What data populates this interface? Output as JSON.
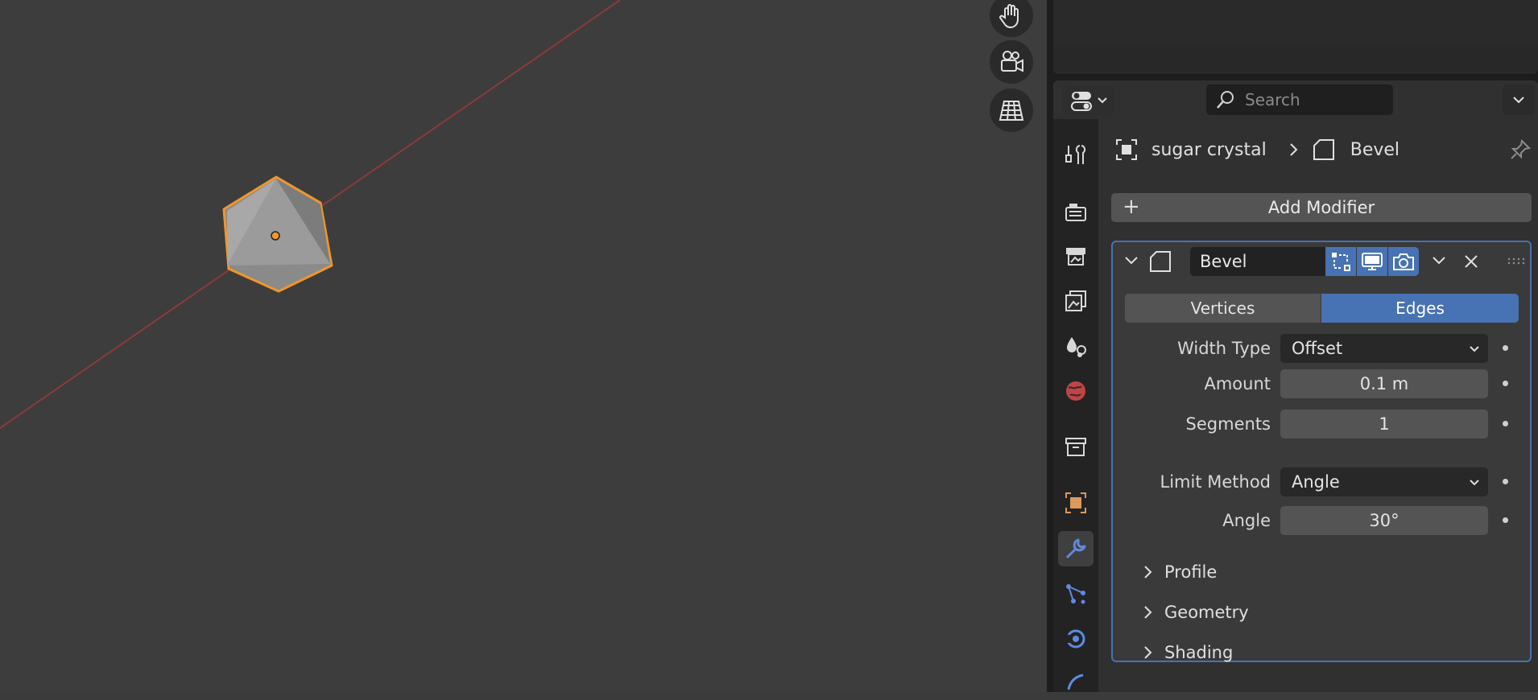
{
  "viewport": {
    "nav_icons": [
      "hand-icon",
      "camera-icon",
      "grid-icon"
    ]
  },
  "properties": {
    "search": {
      "placeholder": "Search"
    },
    "tabs": [
      "tool-icon",
      "render-icon",
      "output-icon",
      "view-layer-icon",
      "scene-icon",
      "world-icon",
      "collection-icon",
      "object-icon",
      "modifier-icon",
      "particles-icon",
      "physics-icon",
      "constraints-icon"
    ],
    "active_tab": "modifier-icon",
    "breadcrumb": {
      "object": "sugar crystal",
      "modifier": "Bevel"
    },
    "add_modifier_label": "Add Modifier",
    "modifier": {
      "name": "Bevel",
      "affect": {
        "options": [
          "Vertices",
          "Edges"
        ],
        "selected": "Edges"
      },
      "width_type": {
        "label": "Width Type",
        "value": "Offset"
      },
      "amount": {
        "label": "Amount",
        "value": "0.1 m"
      },
      "segments": {
        "label": "Segments",
        "value": "1"
      },
      "limit_method": {
        "label": "Limit Method",
        "value": "Angle"
      },
      "angle": {
        "label": "Angle",
        "value": "30°"
      },
      "subpanels": [
        "Profile",
        "Geometry",
        "Shading"
      ]
    }
  },
  "colors": {
    "accent": "#4772b3",
    "selection_outline": "#f0962c",
    "x_axis": "#8c3a3a"
  }
}
